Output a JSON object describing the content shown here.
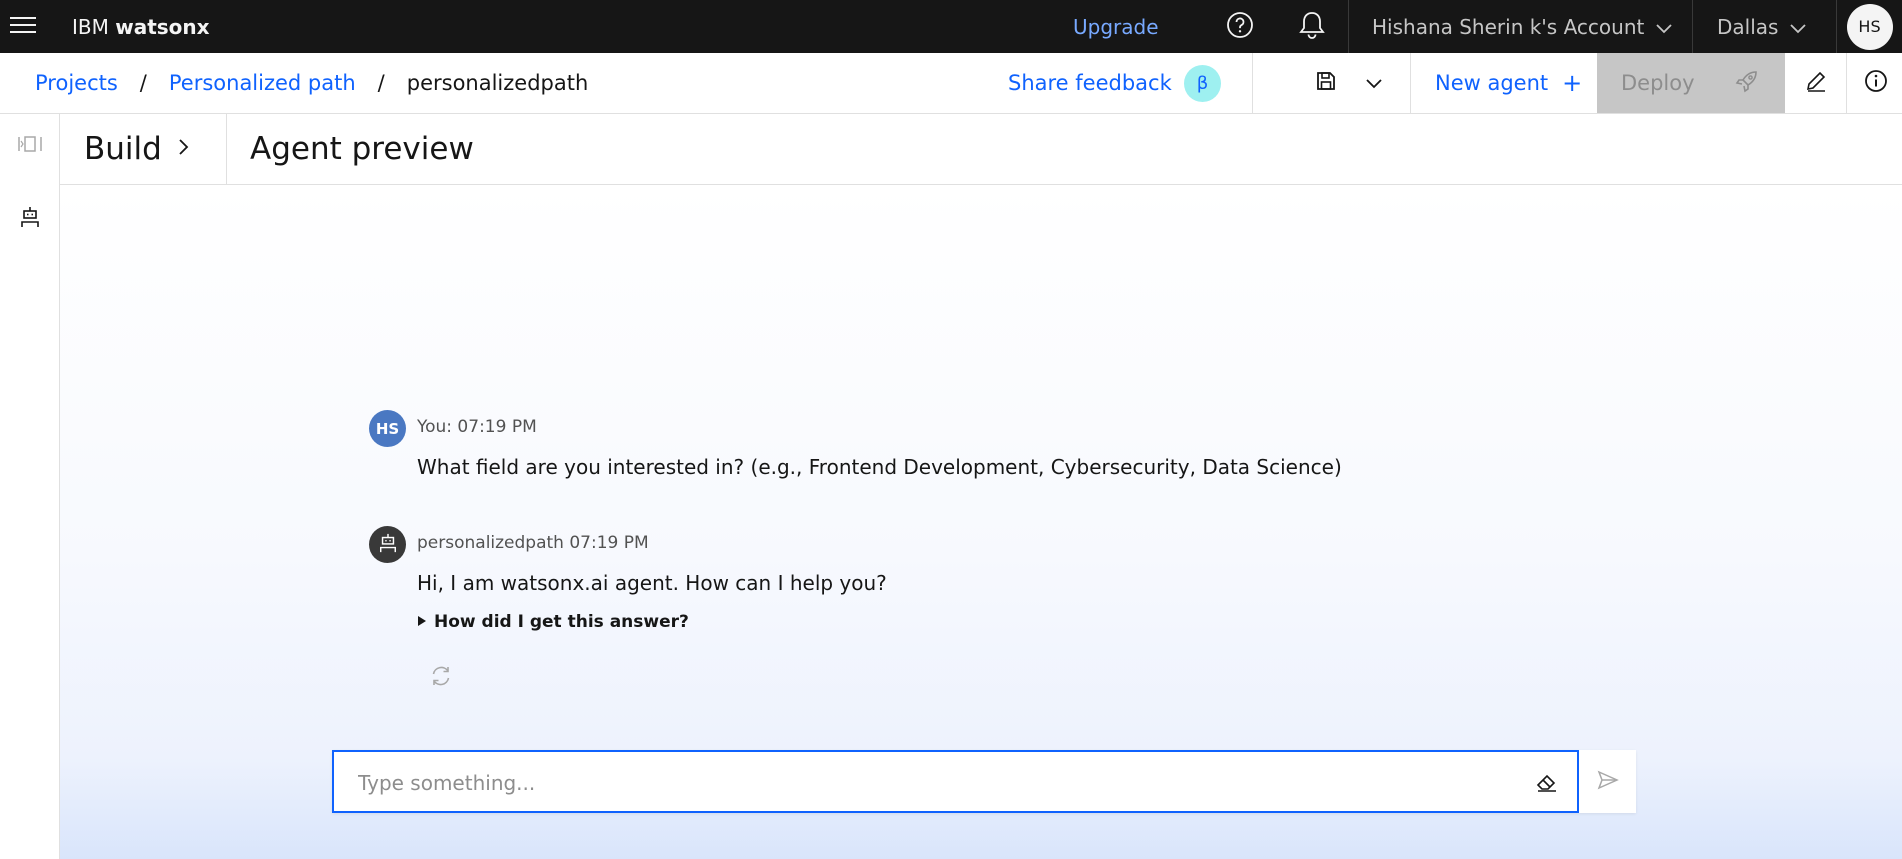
{
  "header": {
    "brand_prefix": "IBM",
    "brand_name": "watsonx",
    "upgrade": "Upgrade",
    "account": "Hishana Sherin k's Account",
    "region": "Dallas",
    "avatar_initials": "HS"
  },
  "breadcrumb": {
    "items": [
      "Projects",
      "Personalized path"
    ],
    "current": "personalizedpath",
    "separator": "/"
  },
  "toolbar": {
    "share_feedback": "Share feedback",
    "beta_badge": "β",
    "new_agent": "New agent",
    "new_agent_icon": "+",
    "deploy": "Deploy"
  },
  "page": {
    "build": "Build",
    "title": "Agent preview"
  },
  "messages": [
    {
      "avatar": "HS",
      "meta": "You: 07:19 PM",
      "text": "What field are you interested in? (e.g., Frontend Development, Cybersecurity, Data Science)"
    },
    {
      "avatar_icon": "robot-icon",
      "meta": "personalizedpath 07:19 PM",
      "text": "Hi, I am watsonx.ai agent. How can I help you?",
      "explain": "How did I get this answer?"
    }
  ],
  "input": {
    "placeholder": "Type something...",
    "value": ""
  },
  "colors": {
    "accent": "#0f62fe",
    "header_bg": "#161616",
    "upgrade_link": "#78a9ff",
    "beta_bg": "#9ef0f0",
    "deploy_disabled": "#c6c6c6"
  }
}
